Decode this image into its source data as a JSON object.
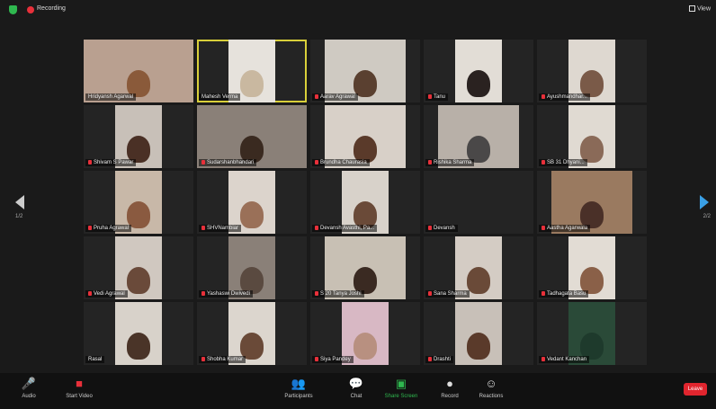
{
  "topbar": {
    "recording_label": "Recording",
    "view_label": "View"
  },
  "participants": [
    {
      "name": "Hridyansh Agarwal",
      "muted": false,
      "active": false,
      "bg": "#b9a090",
      "skin": "#8a5a3a",
      "type": "wide"
    },
    {
      "name": "Mahesh Verma",
      "muted": false,
      "active": true,
      "bg": "#e6e2dc",
      "skin": "#c9b8a0",
      "type": "narrow"
    },
    {
      "name": "Aarav Agrawal",
      "muted": true,
      "active": false,
      "bg": "#cfcac2",
      "skin": "#5a4030",
      "type": "mid"
    },
    {
      "name": "Tanu",
      "muted": true,
      "active": false,
      "bg": "#e2ddd6",
      "skin": "#2a2220",
      "type": "narrow"
    },
    {
      "name": "Ayushmandhar...",
      "muted": true,
      "active": false,
      "bg": "#ded8d0",
      "skin": "#7a5a48",
      "type": "narrow"
    },
    {
      "name": "Shivam S Pawar",
      "muted": true,
      "active": false,
      "bg": "#c8c0b8",
      "skin": "#4a3025",
      "type": "narrow"
    },
    {
      "name": "Sudarshanbhandari",
      "muted": true,
      "active": false,
      "bg": "#8a8078",
      "skin": "#3a2a20",
      "type": "wide"
    },
    {
      "name": "Brundha Chaurasia",
      "muted": true,
      "active": false,
      "bg": "#d8d0c8",
      "skin": "#5a3a2a",
      "type": "mid"
    },
    {
      "name": "Rishika Sharma",
      "muted": true,
      "active": false,
      "bg": "#b8b0a8",
      "skin": "#4a4848",
      "type": "mid"
    },
    {
      "name": "SB 31 Dhyani...",
      "muted": true,
      "active": false,
      "bg": "#e0dad2",
      "skin": "#8a6a58",
      "type": "narrow"
    },
    {
      "name": "Pruha Agrawal",
      "muted": true,
      "active": false,
      "bg": "#c8b8a8",
      "skin": "#8a5a40",
      "type": "narrow"
    },
    {
      "name": "SHVNambiar",
      "muted": true,
      "active": false,
      "bg": "#dcd4cc",
      "skin": "#9a7058",
      "type": "narrow"
    },
    {
      "name": "Devansh Avasthi, Pa...",
      "muted": true,
      "active": false,
      "bg": "#d8d2ca",
      "skin": "#6a4a38",
      "type": "narrow"
    },
    {
      "name": "Devansh",
      "muted": true,
      "active": false,
      "bg": "#242424",
      "skin": "#242424",
      "type": "none"
    },
    {
      "name": "Aastha Agarwala",
      "muted": true,
      "active": false,
      "bg": "#9a7a60",
      "skin": "#4a3028",
      "type": "mid"
    },
    {
      "name": "Vedi Agrawal",
      "muted": true,
      "active": false,
      "bg": "#d0c8c0",
      "skin": "#6a4a3a",
      "type": "narrow"
    },
    {
      "name": "Yashaswi Dwivedi",
      "muted": true,
      "active": false,
      "bg": "#8a8078",
      "skin": "#5a4a40",
      "type": "narrow"
    },
    {
      "name": "S 20 Tanya Joshi",
      "muted": true,
      "active": false,
      "bg": "#c8c0b4",
      "skin": "#3a2a22",
      "type": "mid"
    },
    {
      "name": "Sana Sharma",
      "muted": true,
      "active": false,
      "bg": "#d4ccc4",
      "skin": "#6a4a38",
      "type": "narrow"
    },
    {
      "name": "Tadhagata Basu",
      "muted": true,
      "active": false,
      "bg": "#e2dcd4",
      "skin": "#8a6048",
      "type": "narrow"
    },
    {
      "name": "Rasal",
      "muted": false,
      "active": false,
      "bg": "#d8d2ca",
      "skin": "#4a3428",
      "type": "narrow"
    },
    {
      "name": "Shobha Kumar",
      "muted": true,
      "active": false,
      "bg": "#dcd6ce",
      "skin": "#6a4a38",
      "type": "narrow"
    },
    {
      "name": "Siya Pandey",
      "muted": true,
      "active": false,
      "bg": "#d8b8c4",
      "skin": "#b89080",
      "type": "narrow"
    },
    {
      "name": "Drashti",
      "muted": true,
      "active": false,
      "bg": "#c8c0b8",
      "skin": "#5a3a2a",
      "type": "narrow"
    },
    {
      "name": "Vedant Kanchan",
      "muted": true,
      "active": false,
      "bg": "#2a4a38",
      "skin": "#1e3a2c",
      "type": "narrow"
    }
  ],
  "nav": {
    "page_left": "1/2",
    "page_right": "2/2"
  },
  "toolbar": {
    "audio": "Audio",
    "video": "Start Video",
    "participants": "Participants",
    "participants_count": "50",
    "chat": "Chat",
    "share": "Share Screen",
    "record": "Record",
    "reactions": "Reactions",
    "end": "Leave"
  }
}
